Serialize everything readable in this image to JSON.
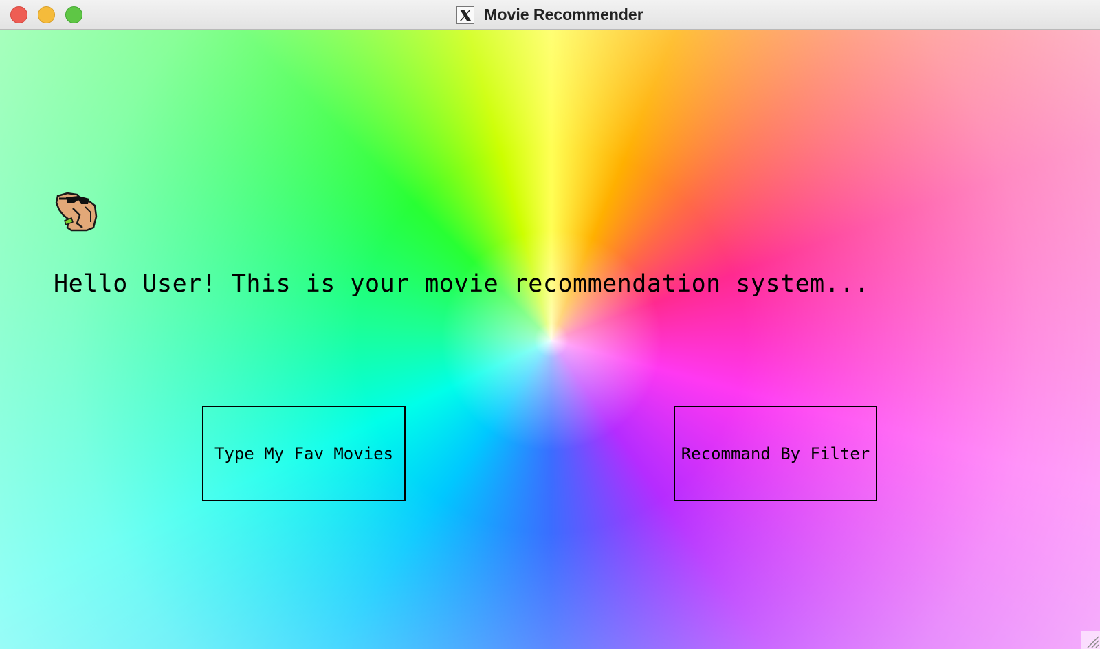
{
  "window": {
    "title": "Movie Recommender",
    "app_icon": "x11-icon",
    "controls": [
      "close",
      "minimize",
      "zoom"
    ]
  },
  "main": {
    "logo_icon": "camel-sunglasses-icon",
    "greeting": "Hello User! This is your movie recommendation system...",
    "buttons": {
      "fav_movies": "Type My Fav Movies",
      "by_filter": "Recommand By Filter"
    }
  },
  "colors": {
    "close": "#ee5d54",
    "minimize": "#f5bb3b",
    "zoom": "#5ec645"
  }
}
